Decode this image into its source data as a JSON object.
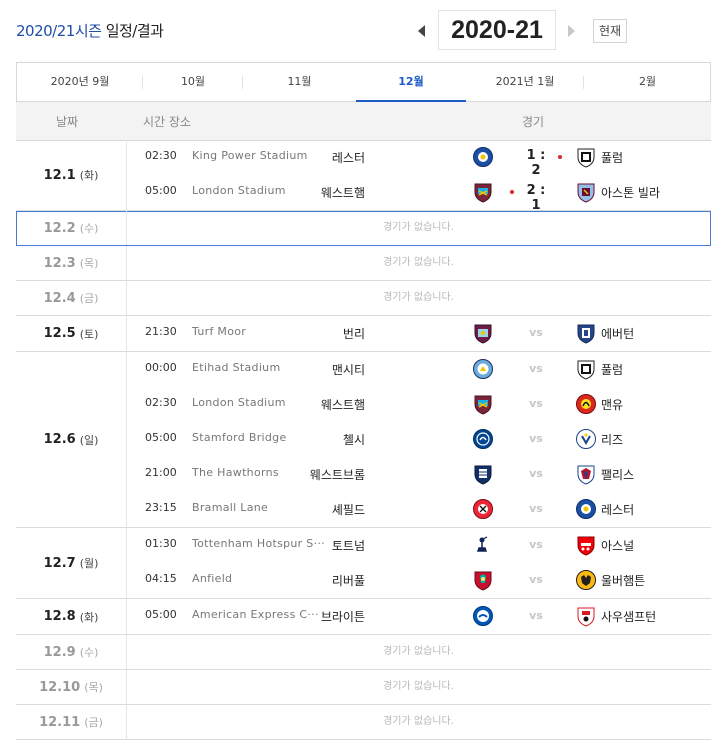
{
  "header": {
    "title_blue": "2020/21시즌",
    "title_rest": " 일정/결과",
    "season": "2020-21",
    "now_label": "현재"
  },
  "months": [
    {
      "label": "2020년 9월",
      "active": false
    },
    {
      "label": "10월",
      "active": false
    },
    {
      "label": "11월",
      "active": false
    },
    {
      "label": "12월",
      "active": true
    },
    {
      "label": "2021년 1월",
      "active": false
    },
    {
      "label": "2월",
      "active": false
    }
  ],
  "table_head": {
    "date": "날짜",
    "time_venue": "시간 장소",
    "match": "경기"
  },
  "no_game_text": "경기가 없습니다.",
  "days": [
    {
      "date": "12.1",
      "dow": "(화)",
      "matches": [
        {
          "time": "02:30",
          "venue": "King Power Stadium",
          "home": "레스터",
          "home_crest": "leicester-crest",
          "away": "풀럼",
          "away_crest": "fulham-crest",
          "score": "1 : 2",
          "winner": "away"
        },
        {
          "time": "05:00",
          "venue": "London Stadium",
          "home": "웨스트햄",
          "home_crest": "westham-crest",
          "away": "아스톤 빌라",
          "away_crest": "astonvilla-crest",
          "score": "2 : 1",
          "winner": "home"
        }
      ]
    },
    {
      "date": "12.2",
      "dow": "(수)",
      "selected": true,
      "matches": []
    },
    {
      "date": "12.3",
      "dow": "(목)",
      "matches": []
    },
    {
      "date": "12.4",
      "dow": "(금)",
      "matches": []
    },
    {
      "date": "12.5",
      "dow": "(토)",
      "matches": [
        {
          "time": "21:30",
          "venue": "Turf Moor",
          "home": "번리",
          "home_crest": "burnley-crest",
          "away": "에버턴",
          "away_crest": "everton-crest",
          "vs": "vs"
        }
      ]
    },
    {
      "date": "12.6",
      "dow": "(일)",
      "matches": [
        {
          "time": "00:00",
          "venue": "Etihad Stadium",
          "home": "맨시티",
          "home_crest": "mancity-crest",
          "away": "풀럼",
          "away_crest": "fulham-crest",
          "vs": "vs"
        },
        {
          "time": "02:30",
          "venue": "London Stadium",
          "home": "웨스트햄",
          "home_crest": "westham-crest",
          "away": "맨유",
          "away_crest": "manutd-crest",
          "vs": "vs"
        },
        {
          "time": "05:00",
          "venue": "Stamford Bridge",
          "home": "첼시",
          "home_crest": "chelsea-crest",
          "away": "리즈",
          "away_crest": "leeds-crest",
          "vs": "vs"
        },
        {
          "time": "21:00",
          "venue": "The Hawthorns",
          "home": "웨스트브롬",
          "home_crest": "westbrom-crest",
          "away": "팰리스",
          "away_crest": "palace-crest",
          "vs": "vs"
        },
        {
          "time": "23:15",
          "venue": "Bramall Lane",
          "home": "셰필드",
          "home_crest": "sheffield-crest",
          "away": "레스터",
          "away_crest": "leicester-crest",
          "vs": "vs"
        }
      ]
    },
    {
      "date": "12.7",
      "dow": "(월)",
      "matches": [
        {
          "time": "01:30",
          "venue": "Tottenham Hotspur S···",
          "home": "토트넘",
          "home_crest": "tottenham-crest",
          "away": "아스널",
          "away_crest": "arsenal-crest",
          "vs": "vs"
        },
        {
          "time": "04:15",
          "venue": "Anfield",
          "home": "리버풀",
          "home_crest": "liverpool-crest",
          "away": "울버햄튼",
          "away_crest": "wolves-crest",
          "vs": "vs"
        }
      ]
    },
    {
      "date": "12.8",
      "dow": "(화)",
      "matches": [
        {
          "time": "05:00",
          "venue": "American Express C···",
          "home": "브라이튼",
          "home_crest": "brighton-crest",
          "away": "사우샘프턴",
          "away_crest": "southampton-crest",
          "vs": "vs"
        }
      ]
    },
    {
      "date": "12.9",
      "dow": "(수)",
      "matches": []
    },
    {
      "date": "12.10",
      "dow": "(목)",
      "matches": []
    },
    {
      "date": "12.11",
      "dow": "(금)",
      "matches": []
    }
  ],
  "colors": {
    "accent": "#1f5bc7",
    "win_dot": "#e0262b"
  }
}
